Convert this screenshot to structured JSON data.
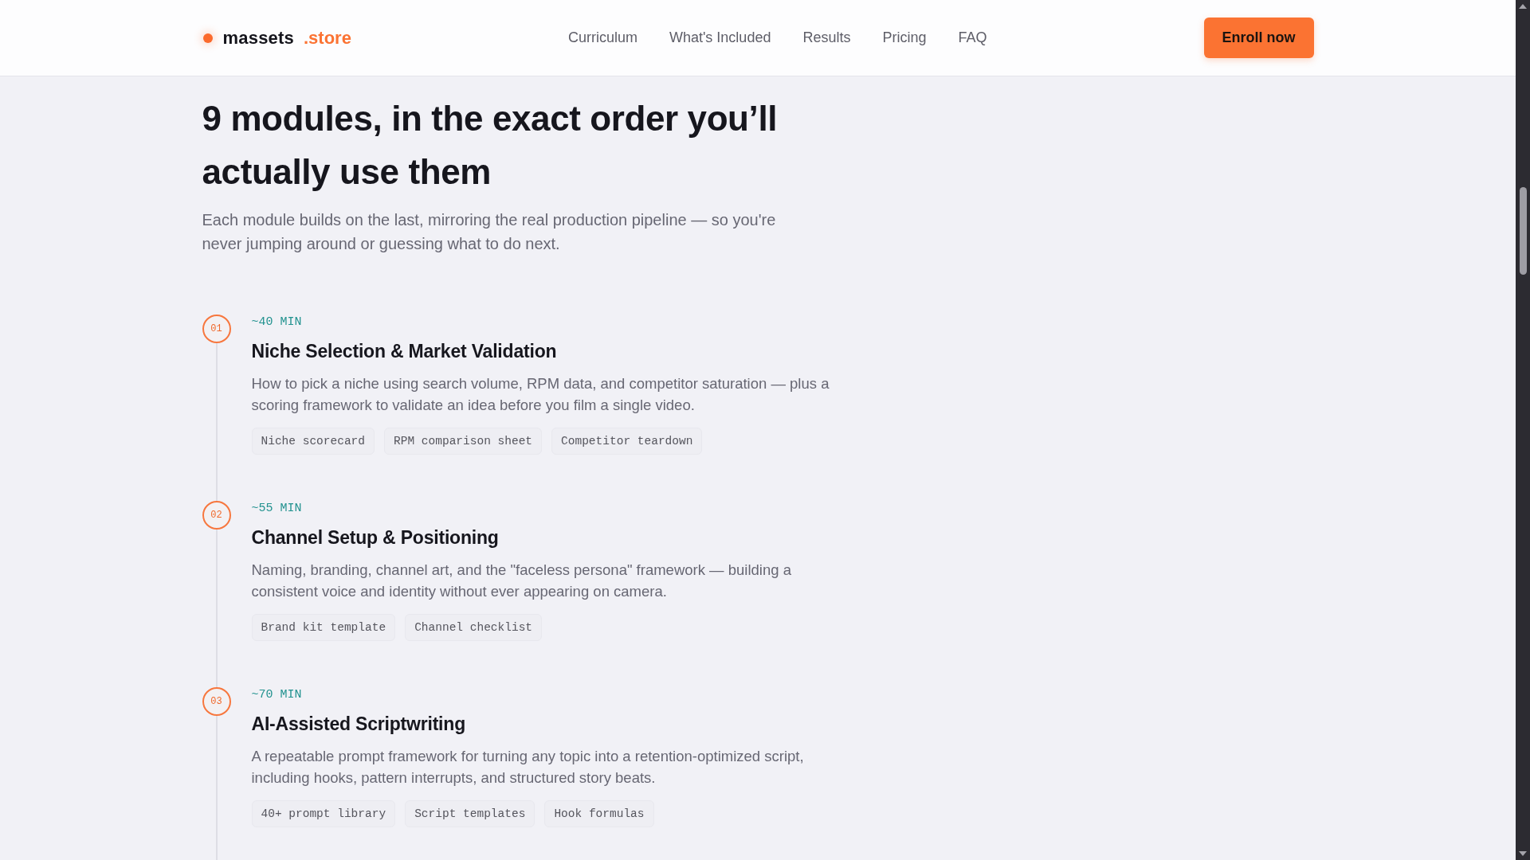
{
  "header": {
    "logo": {
      "name": "massets",
      "suffix": ".store"
    },
    "nav": [
      {
        "label": "Curriculum"
      },
      {
        "label": "What's Included"
      },
      {
        "label": "Results"
      },
      {
        "label": "Pricing"
      },
      {
        "label": "FAQ"
      }
    ],
    "cta": "Enroll now"
  },
  "section": {
    "title": "9 modules, in the exact order you’ll actually use them",
    "subtitle": "Each module builds on the last, mirroring the real production pipeline — so you're never jumping around or guessing what to do next."
  },
  "modules": [
    {
      "number": "01",
      "duration": "~40 MIN",
      "title": "Niche Selection & Market Validation",
      "description": "How to pick a niche using search volume, RPM data, and competitor saturation — plus a scoring framework to validate an idea before you film a single video.",
      "tags": [
        "Niche scorecard",
        "RPM comparison sheet",
        "Competitor teardown"
      ]
    },
    {
      "number": "02",
      "duration": "~55 MIN",
      "title": "Channel Setup & Positioning",
      "description": "Naming, branding, channel art, and the \"faceless persona\" framework — building a consistent voice and identity without ever appearing on camera.",
      "tags": [
        "Brand kit template",
        "Channel checklist"
      ]
    },
    {
      "number": "03",
      "duration": "~70 MIN",
      "title": "AI-Assisted Scriptwriting",
      "description": "A repeatable prompt framework for turning any topic into a retention-optimized script, including hooks, pattern interrupts, and structured story beats.",
      "tags": [
        "40+ prompt library",
        "Script templates",
        "Hook formulas"
      ]
    }
  ]
}
